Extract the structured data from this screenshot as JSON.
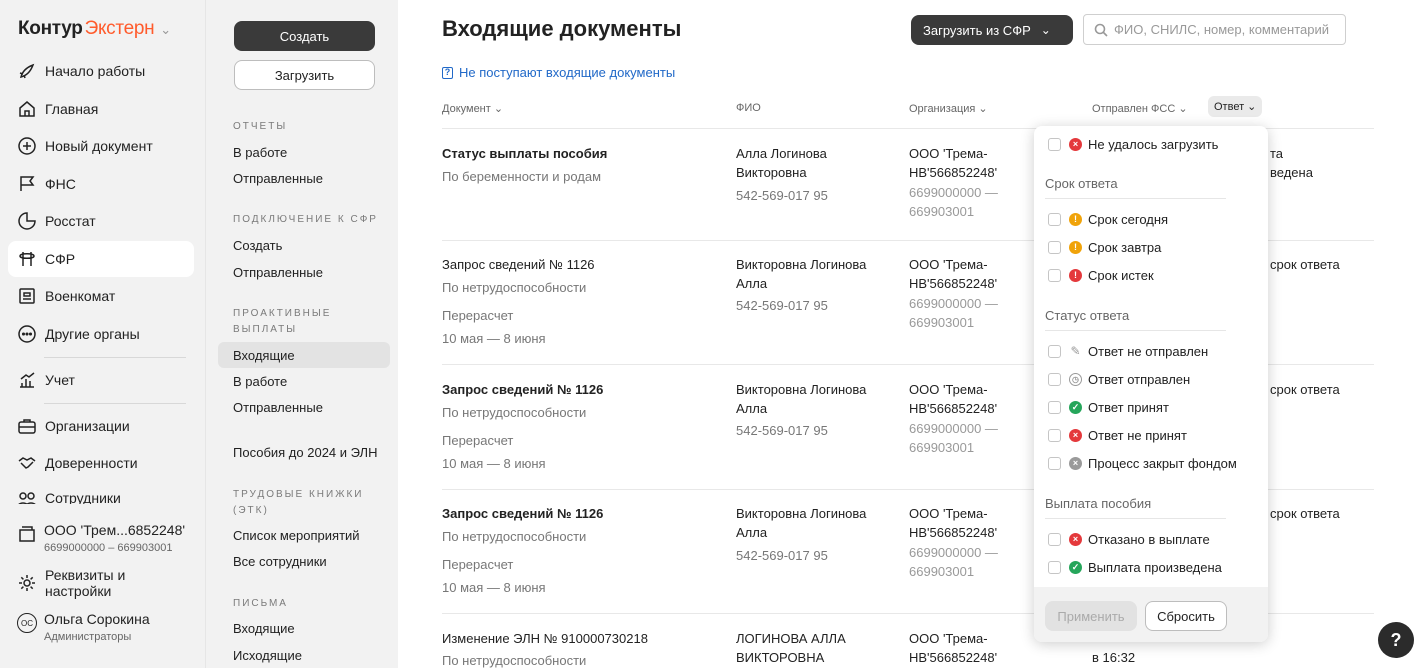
{
  "brand": {
    "part1": "Контур",
    "part2": "Экстерн"
  },
  "nav": {
    "items": [
      {
        "label": "Начало работы",
        "icon": "rocket-icon"
      },
      {
        "label": "Главная",
        "icon": "home-icon"
      },
      {
        "label": "Новый документ",
        "icon": "plus-circle-icon"
      },
      {
        "label": "ФНС",
        "icon": "flag-icon"
      },
      {
        "label": "Росстат",
        "icon": "pie-chart-icon"
      },
      {
        "label": "СФР",
        "icon": "sfr-logo-icon"
      },
      {
        "label": "Военкомат",
        "icon": "military-icon"
      },
      {
        "label": "Другие органы",
        "icon": "more-icon"
      },
      {
        "label": "Учет",
        "icon": "accounting-icon"
      },
      {
        "label": "Организации",
        "icon": "briefcase-icon"
      },
      {
        "label": "Доверенности",
        "icon": "handshake-icon"
      },
      {
        "label": "Сотрудники",
        "icon": "people-icon"
      }
    ],
    "org": {
      "name": "ООО 'Трем...6852248'",
      "ids": "6699000000 – 669903001"
    },
    "settings": "Реквизиты и настройки",
    "user": {
      "initials": "ОС",
      "name": "Ольга Сорокина",
      "role": "Администраторы"
    }
  },
  "subnav": {
    "create": "Создать",
    "upload": "Загрузить",
    "sections": [
      {
        "title": "ОТЧЕТЫ",
        "items": [
          "В работе",
          "Отправленные"
        ]
      },
      {
        "title": "ПОДКЛЮЧЕНИЕ К СФР",
        "items": [
          "Создать",
          "Отправленные"
        ]
      },
      {
        "title": "ПРОАКТИВНЫЕ ВЫПЛАТЫ",
        "items": [
          "Входящие",
          "В работе",
          "Отправленные"
        ]
      },
      {
        "title": "",
        "items": [
          "Пособия до 2024 и ЭЛН"
        ]
      },
      {
        "title": "ТРУДОВЫЕ КНИЖКИ (ЭТК)",
        "items": [
          "Список мероприятий",
          "Все сотрудники"
        ]
      },
      {
        "title": "ПИСЬМА",
        "items": [
          "Входящие",
          "Исходящие"
        ]
      }
    ]
  },
  "main": {
    "title": "Входящие документы",
    "upload_btn": "Загрузить из СФР",
    "search_placeholder": "ФИО, СНИЛС, номер, комментарий",
    "no_docs_link": "Не поступают входящие документы",
    "columns": [
      "Документ",
      "ФИО",
      "Организация",
      "Отправлен ФСС",
      "Ответ"
    ],
    "rows": [
      {
        "doc": "Статус выплаты пособия",
        "sub": "По беременности и родам",
        "extra": "",
        "dates": "",
        "fio1": "Алла Логинова",
        "fio2": "Викторовна",
        "snils": "542-569-017 95",
        "org1": "ООО 'Трема-",
        "org2": "НВ'566852248'",
        "inn1": "6699000000 —",
        "inn2": "669903001",
        "ans1": "та",
        "ans2": "ведена"
      },
      {
        "doc": "Запрос сведений № 1126",
        "sub": "По нетрудоспособности",
        "extra": "Перерасчет",
        "dates": "10 мая — 8 июня",
        "fio1": "Викторовна Логинова",
        "fio2": "Алла",
        "snils": "542-569-017 95",
        "org1": "ООО 'Трема-",
        "org2": "НВ'566852248'",
        "inn1": "6699000000 —",
        "inn2": "669903001",
        "ans1": "срок ответа",
        "ans2": ""
      },
      {
        "doc": "Запрос сведений № 1126",
        "sub": "По нетрудоспособности",
        "extra": "Перерасчет",
        "dates": "10 мая — 8 июня",
        "fio1": "Викторовна Логинова",
        "fio2": "Алла",
        "snils": "542-569-017 95",
        "org1": "ООО 'Трема-",
        "org2": "НВ'566852248'",
        "inn1": "6699000000 —",
        "inn2": "669903001",
        "ans1": "срок ответа",
        "ans2": ""
      },
      {
        "doc": "Запрос сведений № 1126",
        "sub": "По нетрудоспособности",
        "extra": "Перерасчет",
        "dates": "10 мая — 8 июня",
        "fio1": "Викторовна Логинова",
        "fio2": "Алла",
        "snils": "542-569-017 95",
        "org1": "ООО 'Трема-",
        "org2": "НВ'566852248'",
        "inn1": "6699000000 —",
        "inn2": "669903001",
        "ans1": "срок ответа",
        "ans2": ""
      },
      {
        "doc": "Изменение ЭЛН № 910000730218",
        "sub": "По нетрудоспособности",
        "extra": "",
        "dates": "",
        "fio1": "ЛОГИНОВА АЛЛА",
        "fio2": "ВИКТОРОВНА",
        "snils": "",
        "org1": "ООО 'Трема-",
        "org2": "НВ'566852248'",
        "inn1": "",
        "inn2": "",
        "ans1": "в 16:32",
        "ans2": ""
      }
    ]
  },
  "dropdown": {
    "top": {
      "label": "Не удалось загрузить",
      "icon": "error-icon"
    },
    "groups": [
      {
        "title": "Срок ответа",
        "items": [
          {
            "label": "Срок сегодня",
            "icon": "warning-orange-icon"
          },
          {
            "label": "Срок завтра",
            "icon": "warning-orange-icon"
          },
          {
            "label": "Срок истек",
            "icon": "warning-red-icon"
          }
        ]
      },
      {
        "title": "Статус ответа",
        "items": [
          {
            "label": "Ответ не отправлен",
            "icon": "pencil-icon"
          },
          {
            "label": "Ответ отправлен",
            "icon": "clock-icon"
          },
          {
            "label": "Ответ принят",
            "icon": "check-green-icon"
          },
          {
            "label": "Ответ не принят",
            "icon": "error-icon"
          },
          {
            "label": "Процесс закрыт фондом",
            "icon": "closed-grey-icon"
          }
        ]
      },
      {
        "title": "Выплата пособия",
        "items": [
          {
            "label": "Отказано в выплате",
            "icon": "error-icon"
          },
          {
            "label": "Выплата произведена",
            "icon": "check-green-icon"
          }
        ]
      }
    ],
    "apply": "Применить",
    "reset": "Сбросить"
  },
  "help": "?"
}
